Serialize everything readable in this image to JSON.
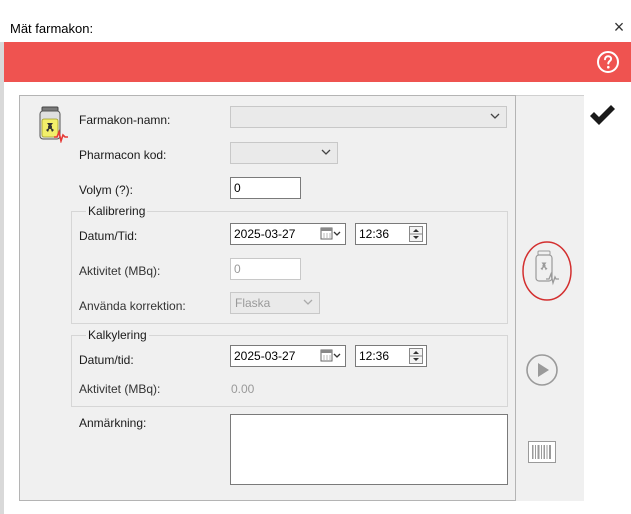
{
  "window": {
    "title": "Mät farmakon:",
    "close_glyph": "×"
  },
  "colors": {
    "accent_red": "#ef5350",
    "annotation_red": "#d32f2f",
    "panel_bg": "#f0f0f0"
  },
  "form": {
    "farmakon_label": "Farmakon-namn:",
    "farmakon_value": "",
    "pharmacon_label": "Pharmacon kod:",
    "pharmacon_value": "",
    "volym_label": "Volym (?):",
    "volym_value": "0",
    "kalibrering": {
      "title": "Kalibrering",
      "datum_label": "Datum/Tid:",
      "date": "2025-03-27",
      "time": "12:36",
      "aktivitet_label": "Aktivitet (MBq):",
      "aktivitet_value": "0",
      "korrektion_label": "Använda korrektion:",
      "korrektion_value": "Flaska"
    },
    "kalkylering": {
      "title": "Kalkylering",
      "datum_label": "Datum/tid:",
      "date": "2025-03-27",
      "time": "12:36",
      "aktivitet_label": "Aktivitet (MBq):",
      "aktivitet_value": "0.00"
    },
    "anmarkning_label": "Anmärkning:",
    "anmarkning_value": ""
  },
  "icons": {
    "help": "question-circle-icon",
    "confirm": "checkmark-icon",
    "measure": "vial-measure-icon",
    "play": "play-icon",
    "barcode": "barcode-icon",
    "vial": "radioactive-vial-icon"
  }
}
